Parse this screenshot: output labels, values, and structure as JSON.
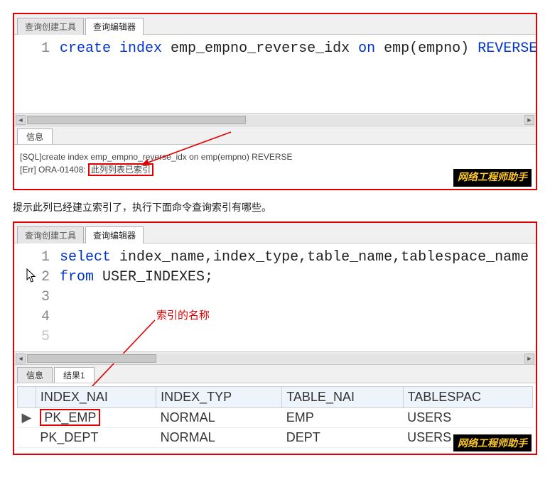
{
  "panel1": {
    "tabs": {
      "builder": "查询创建工具",
      "editor": "查询编辑器"
    },
    "code": {
      "line_no": "1",
      "kw_create": "create index",
      "name": "emp_empno_reverse_idx",
      "kw_on": "on",
      "target": "emp(empno)",
      "kw_reverse": "REVERSE",
      "semicolon": ";"
    },
    "info_tab": "信息",
    "msg_line1_prefix": "[SQL]create index emp_empno_reverse_idx on emp(empno) REVERSE",
    "msg_line2_prefix": "[Err] ORA-01408: ",
    "msg_line2_boxed": "此列列表已索引",
    "watermark": "网络工程师助手"
  },
  "caption": "提示此列已经建立索引了，执行下面命令查询索引有哪些。",
  "panel2": {
    "tabs": {
      "builder": "查询创建工具",
      "editor": "查询编辑器"
    },
    "code": {
      "l1_no": "1",
      "l1_kw": "select",
      "l1_rest": "index_name,index_type,table_name,tablespace_name",
      "l2_no": "2",
      "l2_kw": "from",
      "l2_rest": "USER_INDEXES;",
      "l3_no": "3",
      "l4_no": "4",
      "l5_no": "5"
    },
    "anno_label": "索引的名称",
    "sub_tabs": {
      "info": "信息",
      "result": "结果1"
    },
    "table": {
      "headers": [
        "INDEX_NAI",
        "INDEX_TYP",
        "TABLE_NAI",
        "TABLESPAC"
      ],
      "rows": [
        {
          "marker": "▶",
          "index_name": "PK_EMP",
          "index_type": "NORMAL",
          "table_name": "EMP",
          "tablespace": "USERS"
        },
        {
          "marker": "",
          "index_name": "PK_DEPT",
          "index_type": "NORMAL",
          "table_name": "DEPT",
          "tablespace": "USERS"
        }
      ]
    },
    "watermark": "网络工程师助手"
  }
}
